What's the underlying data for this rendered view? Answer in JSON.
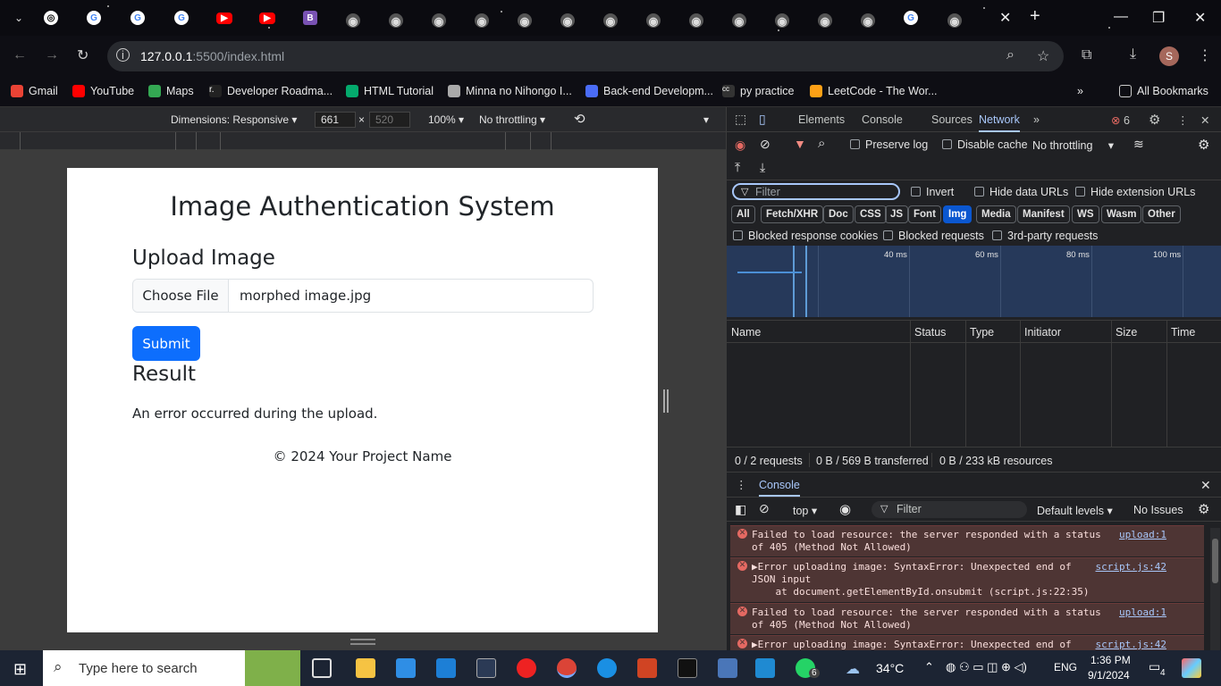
{
  "browser": {
    "url_host": "127.0.0.1",
    "url_rest": ":5500/index.html",
    "bookmarks": [
      "Gmail",
      "YouTube",
      "Maps",
      "Developer Roadma...",
      "HTML Tutorial",
      "Minna no Nihongo I...",
      "Back-end Developm...",
      "py practice",
      "LeetCode - The Wor..."
    ],
    "all_bookmarks": "All Bookmarks",
    "profile_initial": "S"
  },
  "device_toolbar": {
    "dimensions": "Dimensions: Responsive",
    "width": "661",
    "height": "520",
    "zoom": "100%",
    "throttling": "No throttling"
  },
  "page": {
    "title": "Image Authentication System",
    "upload_heading": "Upload Image",
    "choose_file": "Choose File",
    "file_name": "morphed image.jpg",
    "submit": "Submit",
    "result_heading": "Result",
    "result_text": "An error occurred during the upload.",
    "footer": "© 2024 Your Project Name"
  },
  "devtools": {
    "tabs": [
      "Elements",
      "Console",
      "Sources",
      "Network"
    ],
    "active_tab": "Network",
    "error_count": "6",
    "preserve_log": "Preserve log",
    "disable_cache": "Disable cache",
    "throttling": "No throttling",
    "filter_placeholder": "Filter",
    "invert": "Invert",
    "hide_data_urls": "Hide data URLs",
    "hide_extension_urls": "Hide extension URLs",
    "types": [
      "All",
      "Fetch/XHR",
      "Doc",
      "CSS",
      "JS",
      "Font",
      "Img",
      "Media",
      "Manifest",
      "WS",
      "Wasm",
      "Other"
    ],
    "active_type": "Img",
    "blocked_cookies": "Blocked response cookies",
    "blocked_requests": "Blocked requests",
    "third_party": "3rd-party requests",
    "timeline_labels": [
      "40 ms",
      "60 ms",
      "80 ms",
      "100 ms"
    ],
    "columns": [
      "Name",
      "Status",
      "Type",
      "Initiator",
      "Size",
      "Time"
    ],
    "summary": [
      "0 / 2 requests",
      "0 B / 569 B transferred",
      "0 B / 233 kB resources"
    ],
    "drawer_tab": "Console",
    "context": "top",
    "console_filter": "Filter",
    "levels": "Default levels",
    "issues": "No Issues",
    "messages": [
      {
        "text1": "Failed to load resource: the server responded with a status",
        "text2": "of 405 (Method Not Allowed)",
        "source": "upload:1"
      },
      {
        "text1": "▶Error uploading image: SyntaxError: Unexpected end of",
        "text2": "JSON input",
        "text3": "    at document.getElementById.onsubmit (script.js:22:35)",
        "source": "script.js:42"
      },
      {
        "text1": "Failed to load resource: the server responded with a status",
        "text2": "of 405 (Method Not Allowed)",
        "source": "upload:1"
      },
      {
        "text1": "▶Error uploading image: SyntaxError: Unexpected end of",
        "source": "script.js:42"
      }
    ]
  },
  "taskbar": {
    "search_placeholder": "Type here to search",
    "temperature": "34°C",
    "language": "ENG",
    "time": "1:36 PM",
    "date": "9/1/2024",
    "notifications": "4",
    "whatsapp_badge": "6"
  }
}
